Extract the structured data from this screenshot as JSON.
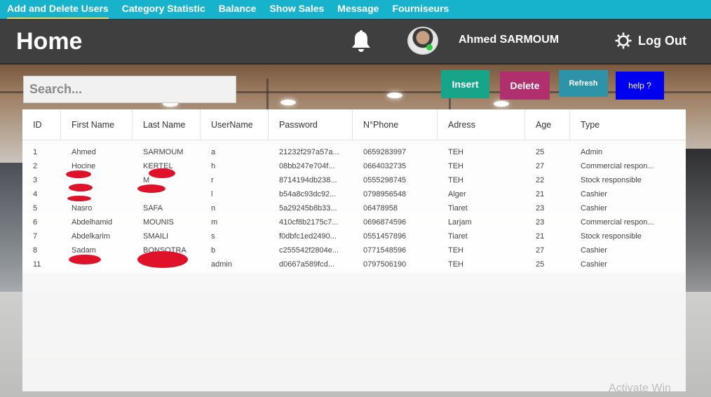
{
  "nav": {
    "items": [
      {
        "label": "Add and Delete Users",
        "active": true
      },
      {
        "label": "Category Statistic"
      },
      {
        "label": "Balance"
      },
      {
        "label": "Show Sales"
      },
      {
        "label": "Message"
      },
      {
        "label": "Fourniseurs"
      }
    ]
  },
  "header": {
    "title": "Home",
    "bell_icon": "bell-icon",
    "user_name": "Ahmed SARMOUM",
    "logout_label": "Log Out",
    "logout_icon": "gear-icon"
  },
  "toolbar": {
    "search_placeholder": "Search...",
    "insert_label": "Insert",
    "delete_label": "Delete",
    "refresh_label": "Refresh",
    "help_label": "help ?"
  },
  "table": {
    "columns": [
      "ID",
      "First Name",
      "Last Name",
      "UserName",
      "Password",
      "N°Phone",
      "Adress",
      "Age",
      "Type"
    ],
    "rows": [
      [
        "1",
        "Ahmed",
        "SARMOUM",
        "a",
        "21232f297a57a...",
        "0659283997",
        "TEH",
        "25",
        "Admin"
      ],
      [
        "2",
        "Hocine",
        "KERTEL",
        "h",
        "08bb247e704f...",
        "0664032735",
        "TEH",
        "27",
        "Commercial respon..."
      ],
      [
        "3",
        "",
        "M",
        "r",
        "8714194db238...",
        "0555298745",
        "TEH",
        "22",
        "Stock responsible"
      ],
      [
        "4",
        "",
        "",
        "l",
        "b54a8c93dc92...",
        "0798956548",
        "Alger",
        "21",
        "Cashier"
      ],
      [
        "5",
        "Nasro",
        "SAFA",
        "n",
        "5a29245b8b33...",
        "06478958",
        "Tiaret",
        "23",
        "Cashier"
      ],
      [
        "6",
        "Abdelhamid",
        "MOUNIS",
        "m",
        "410cf8b2175c7...",
        "0696874596",
        "Larjam",
        "23",
        "Commercial respon..."
      ],
      [
        "7",
        "Abdelkarim",
        "SMAILI",
        "s",
        "f0dbfc1ed2490...",
        "0551457896",
        "Tiaret",
        "21",
        "Stock responsible"
      ],
      [
        "8",
        "Sadam",
        "BONSOTRA",
        "b",
        "c255542f2804e...",
        "0771548596",
        "TEH",
        "27",
        "Cashier"
      ],
      [
        "11",
        "",
        "",
        "admin",
        "d0667a589fcd...",
        "0797506190",
        "TEH",
        "25",
        "Cashier"
      ]
    ]
  },
  "colors": {
    "nav_bg": "#17b3cc",
    "header_bg": "#3f3f3f",
    "insert": "#16a589",
    "delete": "#b0306d",
    "refresh": "#2c93a8",
    "help": "#0000f0",
    "redaction": "#e0122a"
  },
  "watermark": "Activate Win"
}
